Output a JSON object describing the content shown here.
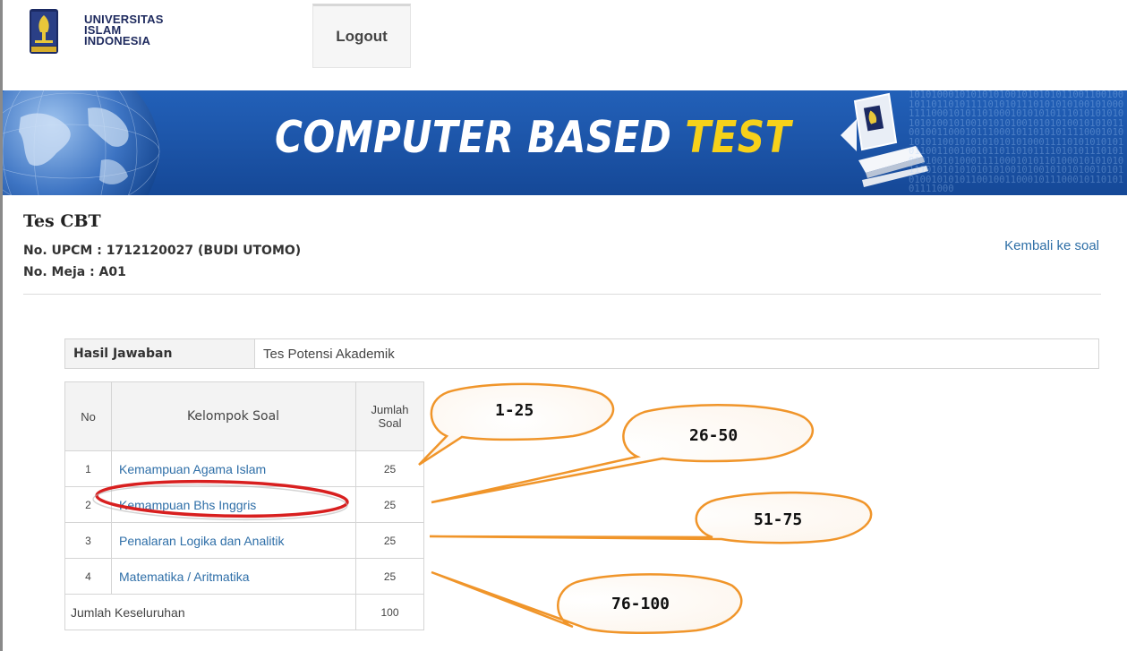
{
  "header": {
    "logo_lines": [
      "UNIVERSITAS",
      "ISLAM",
      "INDONESIA"
    ],
    "logout_label": "Logout"
  },
  "banner": {
    "title_main": "COMPUTER BASED",
    "title_highlight": "TEST",
    "binary_text": "1010100010101010100101010101100110010010110110101111010101110101010100101000111100010101101000101010101110101010101010100101001010101001010101001010101100100110001011100010110101011110001010101011001010101010101000111101010101010110011001001011011010111101010111010101010010100011110001010110100010101010111010101010101010010100101010100101010100101010110010011000101110001011010101111000"
  },
  "page": {
    "title": "Tes CBT",
    "no_upcm_line": "No. UPCM : 1712120027 (BUDI UTOMO)",
    "no_meja_line": "No. Meja : A01",
    "back_link": "Kembali ke soal"
  },
  "hasil": {
    "label": "Hasil Jawaban",
    "value": "Tes Potensi Akademik"
  },
  "table": {
    "headers": {
      "no": "No",
      "kelompok": "Kelompok Soal",
      "jumlah_line1": "Jumlah",
      "jumlah_line2": "Soal"
    },
    "rows": [
      {
        "no": "1",
        "kelompok": "Kemampuan Agama Islam",
        "jumlah": "25"
      },
      {
        "no": "2",
        "kelompok": "Kemampuan Bhs Inggris",
        "jumlah": "25"
      },
      {
        "no": "3",
        "kelompok": "Penalaran Logika dan Analitik",
        "jumlah": "25"
      },
      {
        "no": "4",
        "kelompok": "Matematika / Aritmatika",
        "jumlah": "25"
      }
    ],
    "total_label": "Jumlah Keseluruhan",
    "total_value": "100"
  },
  "annotations": {
    "callouts": [
      "1-25",
      "26-50",
      "51-75",
      "76-100"
    ],
    "callout_color": "#f0952a",
    "highlight_ellipse_color": "#d81f1f"
  },
  "colors": {
    "banner_blue": "#1d56aa",
    "title_highlight": "#f6d11a",
    "link": "#2f6fa8"
  }
}
